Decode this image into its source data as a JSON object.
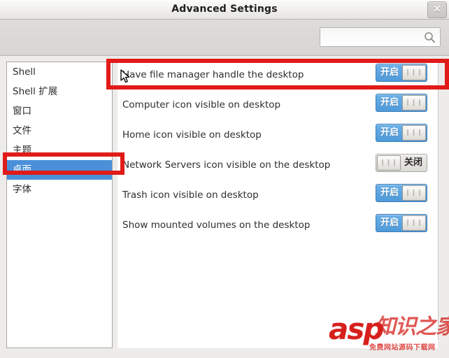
{
  "window": {
    "title": "Advanced Settings",
    "close_label": "×"
  },
  "toolbar": {
    "search_placeholder": "",
    "search_value": "",
    "search_icon": "search-icon"
  },
  "sidebar": {
    "items": [
      {
        "label": "Shell",
        "selected": false
      },
      {
        "label": "Shell 扩展",
        "selected": false
      },
      {
        "label": "窗口",
        "selected": false
      },
      {
        "label": "文件",
        "selected": false
      },
      {
        "label": "主题",
        "selected": false
      },
      {
        "label": "桌面",
        "selected": true
      },
      {
        "label": "字体",
        "selected": false
      }
    ]
  },
  "toggle_labels": {
    "on": "开启",
    "off": "关闭",
    "grip": "❙❙❙"
  },
  "preferences": {
    "rows": [
      {
        "label": "Have file manager handle the desktop",
        "state": "on",
        "state_label": "开启"
      },
      {
        "label": "Computer icon visible on desktop",
        "state": "on",
        "state_label": "开启"
      },
      {
        "label": "Home icon visible on desktop",
        "state": "on",
        "state_label": "开启"
      },
      {
        "label": "Network Servers icon visible on the desktop",
        "state": "off",
        "state_label": "关闭"
      },
      {
        "label": "Trash icon visible on desktop",
        "state": "on",
        "state_label": "开启"
      },
      {
        "label": "Show mounted volumes on the desktop",
        "state": "on",
        "state_label": "开启"
      }
    ]
  },
  "annotations": {
    "color": "#e01b18",
    "boxes": [
      {
        "name": "highlight-first-preference-row"
      },
      {
        "name": "highlight-sidebar-desktop-item"
      }
    ]
  },
  "watermark": {
    "brand": "asp",
    "brand_cn": "知识之家",
    "tagline": "免费网站源码下载网"
  },
  "colors": {
    "accent_blue": "#4a90d9",
    "annotation_red": "#e01b18",
    "watermark_red": "#d6201c",
    "window_bg": "#edecea",
    "toolbar_bg": "#d6d5d2"
  }
}
